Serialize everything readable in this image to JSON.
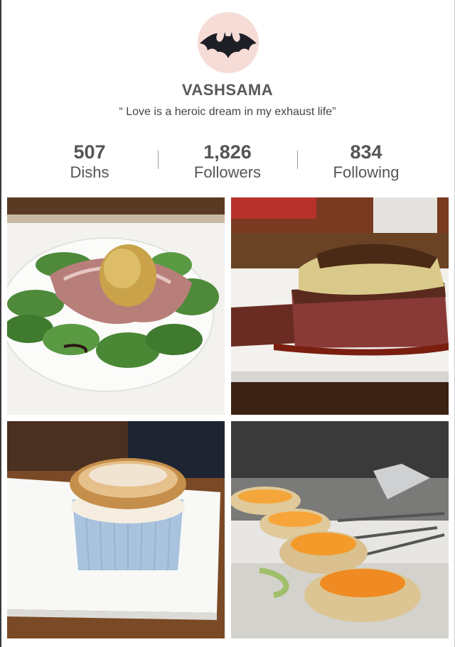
{
  "profile": {
    "avatar_icon": "batman-logo-icon",
    "username": "VASHSAMA",
    "bio": "“ Love is a heroic dream in my exhaust life”"
  },
  "stats": [
    {
      "value": "507",
      "label": "Dishs"
    },
    {
      "value": "1,826",
      "label": "Followers"
    },
    {
      "value": "834",
      "label": "Following"
    }
  ],
  "photos": [
    {
      "subject": "egg-salad-with-prosciutto"
    },
    {
      "subject": "steak-with-foie-gras"
    },
    {
      "subject": "souffle"
    },
    {
      "subject": "marinated-eggs-on-spoons"
    }
  ],
  "colors": {
    "avatar_bg": "#f6dcd6",
    "text": "#555555"
  }
}
